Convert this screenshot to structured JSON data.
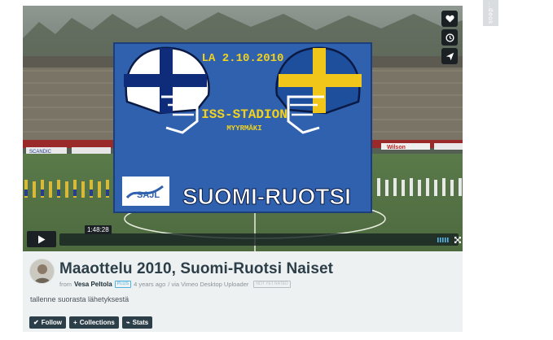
{
  "side_tab": {
    "label": "...deos"
  },
  "player": {
    "graphic": {
      "date": "LA 2.10.2010",
      "venue": "ISS-STADION",
      "place": "MYYRMÄKI",
      "org": "SAJL",
      "match": "SUOMI-RUOTSI"
    },
    "ads": [
      "SCANDIC",
      "Wilson"
    ],
    "side_buttons": [
      {
        "name": "like-button",
        "icon": "heart-icon"
      },
      {
        "name": "watch-later-button",
        "icon": "clock-icon"
      },
      {
        "name": "share-button",
        "icon": "send-icon"
      }
    ],
    "duration": "1:48:28",
    "colors": {
      "finland_blue": "#0f2c7a",
      "sweden_blue": "#1d4f9c",
      "sweden_yellow": "#f0c61b",
      "panel": "#2f61ae"
    }
  },
  "video": {
    "title": "Maaottelu 2010, Suomi-Ruotsi Naiset",
    "from_label": "from",
    "owner": "Vesa Peltola",
    "owner_badge": "PLUS",
    "age": "4 years ago",
    "via": "/ via Vimeo Desktop Uploader",
    "nsfw_badge": "NOT YET RATED",
    "description": "tallenne suorasta lähetyksestä"
  },
  "actions": [
    {
      "name": "follow-button",
      "icon": "check-icon",
      "glyph": "✔",
      "label": "Follow"
    },
    {
      "name": "collections-button",
      "icon": "plus-icon",
      "glyph": "+",
      "label": "Collections"
    },
    {
      "name": "stats-button",
      "icon": "stats-icon",
      "glyph": "⌁",
      "label": "Stats"
    }
  ]
}
